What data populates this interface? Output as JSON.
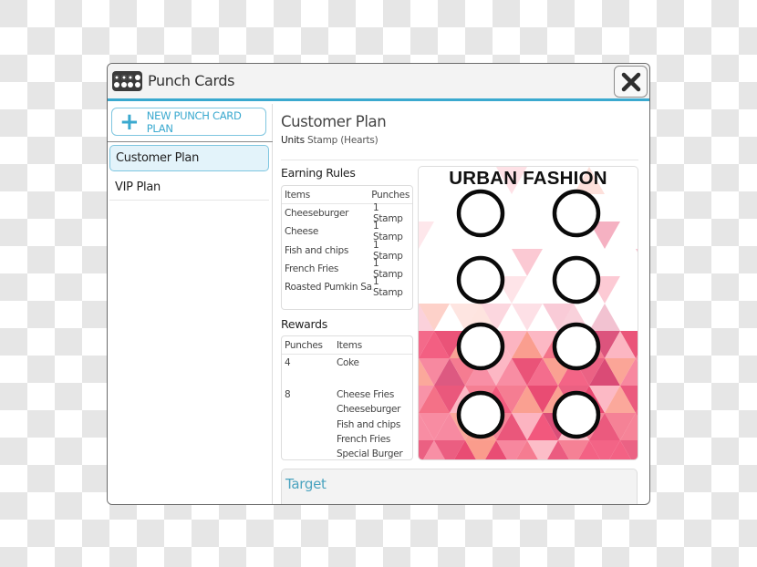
{
  "window": {
    "title": "Punch Cards",
    "icons": {
      "app": "punch-card-icon",
      "close": "close-icon"
    }
  },
  "sidebar": {
    "new_plan_label": "NEW PUNCH CARD PLAN",
    "new_plan_icon": "plus-icon",
    "plans": [
      {
        "label": "Customer Plan",
        "selected": true
      },
      {
        "label": "VIP Plan",
        "selected": false
      }
    ]
  },
  "plan": {
    "title": "Customer Plan",
    "units_label": "Units",
    "units_value": "Stamp (Hearts)"
  },
  "earning_rules": {
    "title": "Earning Rules",
    "headers": [
      "Items",
      "Punches"
    ],
    "rows": [
      [
        "Cheeseburger",
        "1 Stamp"
      ],
      [
        "Cheese",
        "1 Stamp"
      ],
      [
        "Fish and chips",
        "1 Stamp"
      ],
      [
        "French Fries",
        "1 Stamp"
      ],
      [
        "Roasted Pumkin Sa...",
        "1 Stamp"
      ]
    ]
  },
  "rewards": {
    "title": "Rewards",
    "headers": [
      "Punches",
      "Items"
    ],
    "rows": [
      {
        "punches": "4",
        "items": [
          "Coke"
        ]
      },
      {
        "punches": "8",
        "items": [
          "Cheese Fries",
          "Cheeseburger",
          "Fish and chips",
          "French Fries",
          "Special Burger"
        ]
      }
    ]
  },
  "card_preview": {
    "brand": "URBAN FASHION",
    "stamp_slots": 8,
    "stamps_filled": 0,
    "pattern_colors": [
      "#f2557a",
      "#f7839b",
      "#e8466e",
      "#fa9a8a",
      "#f46f86",
      "#d94773",
      "#fcb3c0"
    ]
  },
  "target": {
    "label": "Target"
  }
}
